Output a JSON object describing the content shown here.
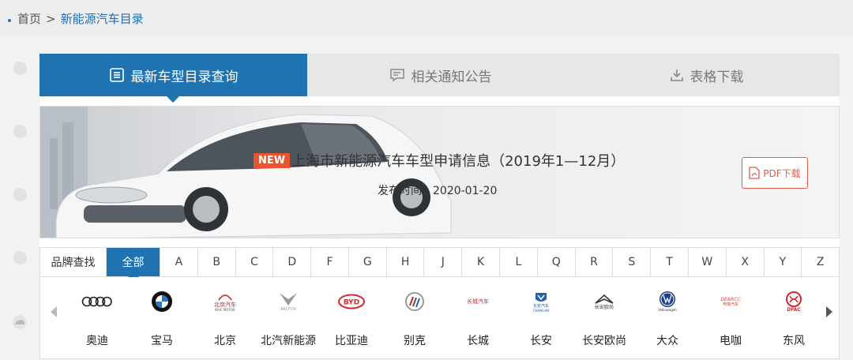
{
  "breadcrumb": {
    "home": "首页",
    "separator": ">",
    "current": "新能源汽车目录"
  },
  "tabs": [
    {
      "label": "最新车型目录查询",
      "icon": "list-icon"
    },
    {
      "label": "相关通知公告",
      "icon": "message-icon"
    },
    {
      "label": "表格下载",
      "icon": "download-icon"
    }
  ],
  "banner": {
    "badge": "NEW",
    "title": "上海市新能源汽车车型申请信息（2019年1—12月）",
    "date_label": "发布时间：",
    "date": "2020-01-20",
    "pdf_button": "PDF下载"
  },
  "brand_filter": {
    "label": "品牌查找",
    "all": "全部",
    "letters": [
      "A",
      "B",
      "C",
      "D",
      "F",
      "G",
      "H",
      "J",
      "K",
      "L",
      "Q",
      "R",
      "S",
      "T",
      "W",
      "X",
      "Y",
      "Z"
    ]
  },
  "brands": [
    {
      "name": "奥迪",
      "logo": "audi-logo"
    },
    {
      "name": "宝马",
      "logo": "bmw-logo"
    },
    {
      "name": "北京",
      "logo": "baic-logo",
      "logo_text": "北京汽车",
      "logo_sub": "BAIC MOTOR"
    },
    {
      "name": "北汽新能源",
      "logo": "arcfox-logo",
      "logo_text": "ARCFOX"
    },
    {
      "name": "比亚迪",
      "logo": "byd-logo",
      "logo_text": "BYD"
    },
    {
      "name": "别克",
      "logo": "buick-logo"
    },
    {
      "name": "长城",
      "logo": "greatwall-logo",
      "logo_text": "长城汽车"
    },
    {
      "name": "长安",
      "logo": "changan-logo",
      "logo_text": "长安汽车",
      "logo_sub": "CHANGAN"
    },
    {
      "name": "长安欧尚",
      "logo": "oshan-logo",
      "logo_text": "长安欧尚"
    },
    {
      "name": "大众",
      "logo": "vw-logo",
      "logo_text": "Volkswagen"
    },
    {
      "name": "电咖",
      "logo": "enovate-logo",
      "logo_text": "DEARCC",
      "logo_sub": "电咖汽车"
    },
    {
      "name": "东风",
      "logo": "dfac-logo",
      "logo_text": "DFAC"
    }
  ],
  "colors": {
    "primary": "#1f73b1",
    "accent": "#e05a4e",
    "new_badge": "#e8542f"
  }
}
